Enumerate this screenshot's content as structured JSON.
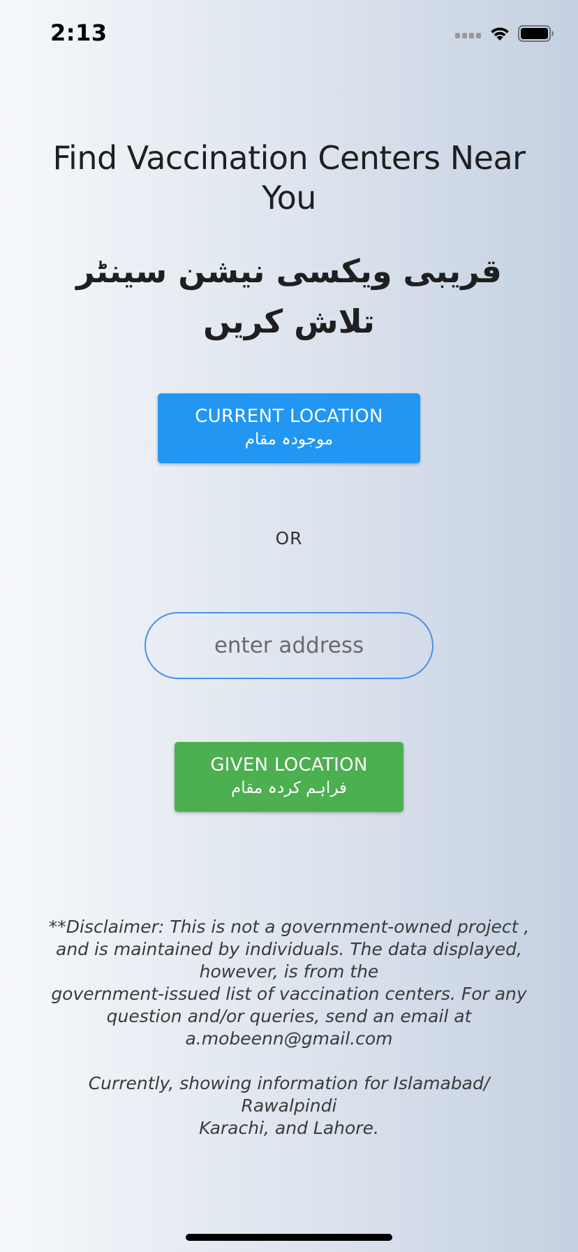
{
  "status_bar": {
    "time": "2:13"
  },
  "title": {
    "english": "Find Vaccination Centers Near You",
    "urdu": "قریبی ویکسی نیشن سینٹر تلاش کریں"
  },
  "current_location_button": {
    "label": "CURRENT LOCATION",
    "label_urdu": "موجودہ مقام",
    "color": "#2196f3"
  },
  "or_label": "OR",
  "address_input": {
    "placeholder": "enter address",
    "value": ""
  },
  "given_location_button": {
    "label": "GIVEN LOCATION",
    "label_urdu": "فراہم کردہ مقام",
    "color": "#4caf50"
  },
  "disclaimer": {
    "line1": "**Disclaimer: This is not a government-owned project , and is maintained by individuals. The data displayed, however, is from the",
    "line2": "government-issued list of vaccination centers. For any question and/or queries, send an email at a.mobeenn@gmail.com",
    "line3": "Currently, showing information for Islamabad/ Rawalpindi",
    "line4": "Karachi, and Lahore."
  },
  "icons": {
    "signal": "cellular-signal-icon",
    "wifi": "wifi-icon",
    "battery": "battery-icon"
  }
}
